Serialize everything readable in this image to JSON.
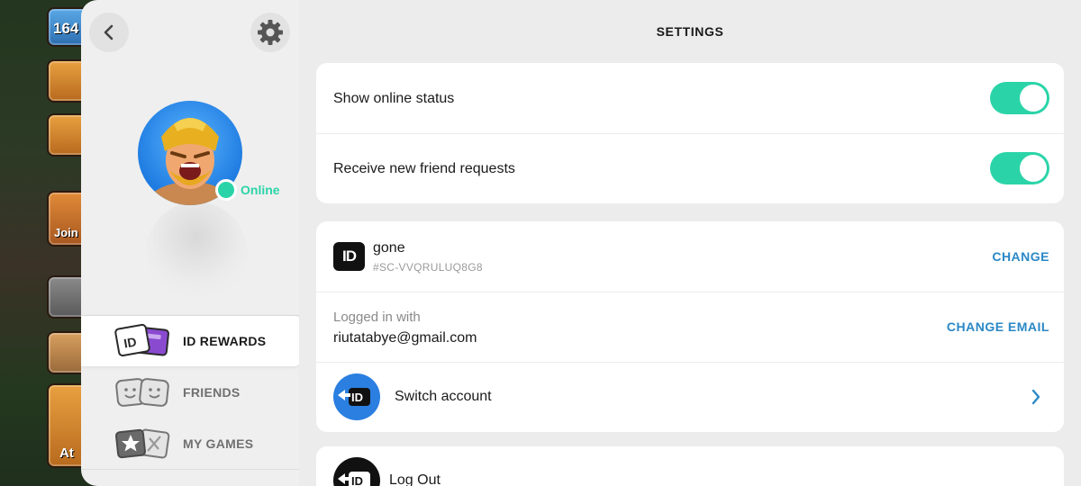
{
  "game_background": {
    "trophy_count": "164",
    "join_label": "Join",
    "attack_label": "At"
  },
  "sidebar": {
    "status": {
      "label": "Online",
      "color": "#2bd4a8"
    },
    "items": [
      {
        "label": "ID REWARDS",
        "icon": "id-rewards-icon",
        "selected": true
      },
      {
        "label": "FRIENDS",
        "icon": "friends-icon",
        "selected": false
      },
      {
        "label": "MY GAMES",
        "icon": "my-games-icon",
        "selected": false
      }
    ]
  },
  "header": {
    "title": "SETTINGS"
  },
  "privacy": {
    "show_online_status": {
      "label": "Show online status",
      "enabled": true
    },
    "receive_friend_requests": {
      "label": "Receive new friend requests",
      "enabled": true
    }
  },
  "account": {
    "id_badge": "ID",
    "username": "gone",
    "tag": "#SC-VVQRULUQ8G8",
    "change_label": "CHANGE",
    "logged_in_label": "Logged in with",
    "email": "riutatabye@gmail.com",
    "change_email_label": "CHANGE EMAIL",
    "switch_account_label": "Switch account"
  },
  "logout": {
    "label": "Log Out"
  },
  "colors": {
    "accent_green": "#2bd4a8",
    "link_blue": "#2a88c6"
  }
}
